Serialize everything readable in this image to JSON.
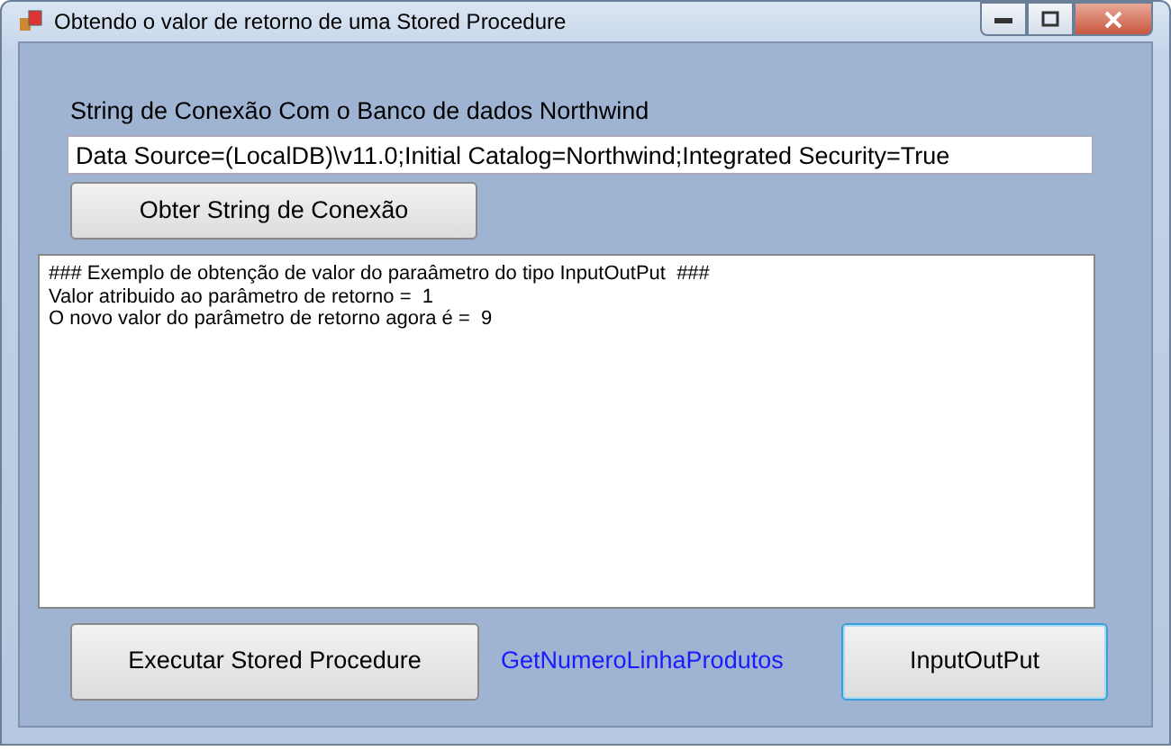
{
  "window": {
    "title": "Obtendo o valor de retorno de uma Stored Procedure"
  },
  "connection_label": "String de Conexão Com o Banco de dados Northwind",
  "connection_field": {
    "value": "Data Source=(LocalDB)\\v11.0;Initial Catalog=Northwind;Integrated Security=True"
  },
  "get_connection_button": {
    "label": "Obter String de Conexão",
    "focused": false
  },
  "output_lines": [
    "### Exemplo de obtenção de valor do paraâmetro do tipo InputOutPut  ###",
    "Valor atribuido ao parâmetro de retorno =  1",
    "O novo valor do parâmetro de retorno agora é =  9"
  ],
  "execute_button": {
    "label": "Executar Stored Procedure",
    "focused": false
  },
  "procedure_name": "GetNumeroLinhaProdutos",
  "input_output_button": {
    "label": "InputOutPut",
    "focused": true
  }
}
